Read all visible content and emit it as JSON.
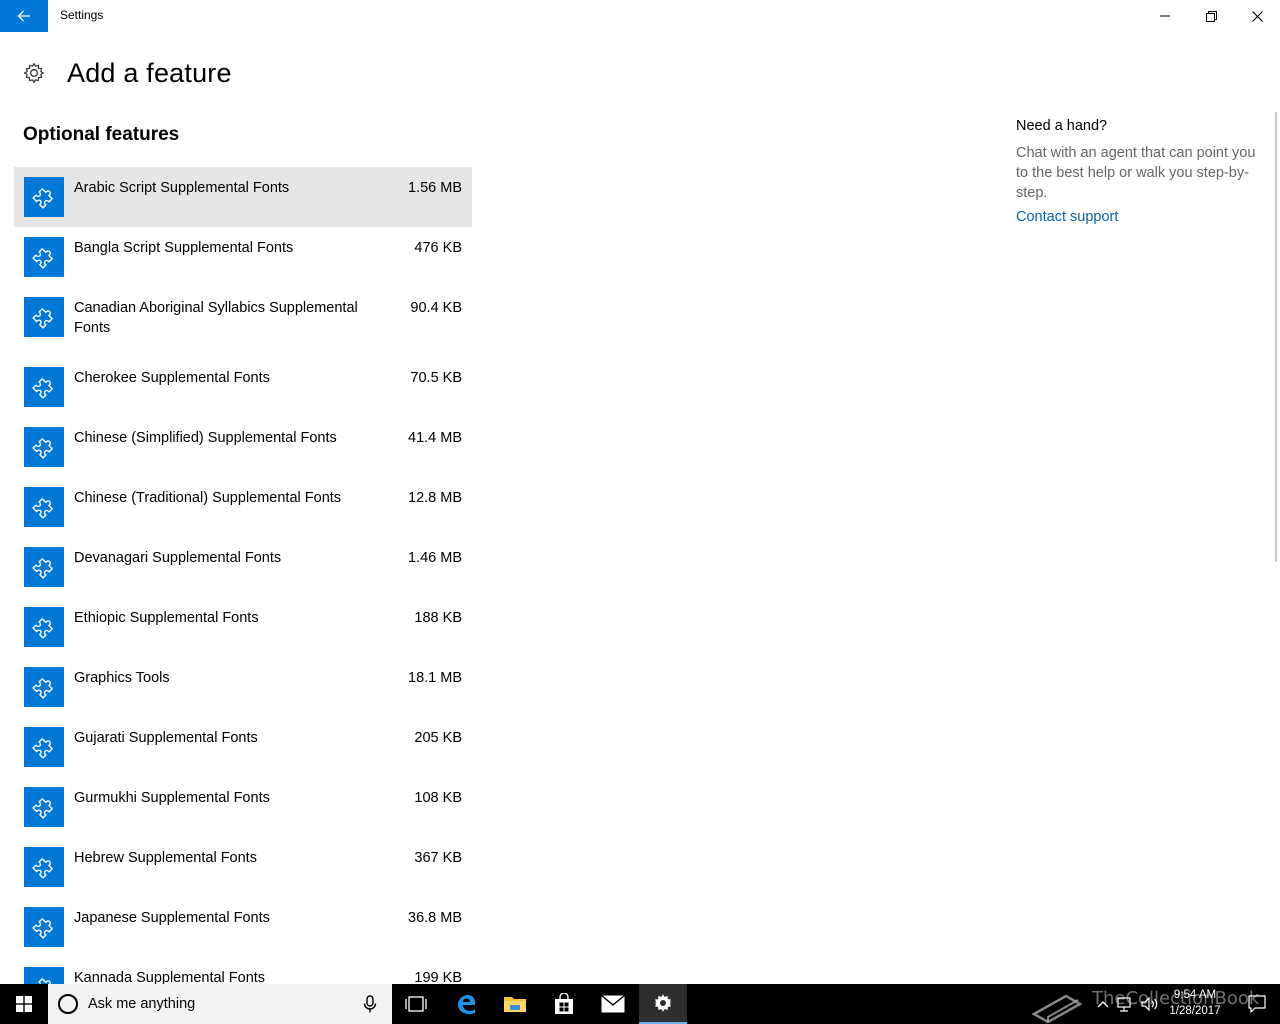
{
  "window": {
    "title": "Settings"
  },
  "page": {
    "title": "Add a feature",
    "section_title": "Optional features"
  },
  "features": [
    {
      "name": "Arabic Script Supplemental Fonts",
      "size": "1.56 MB"
    },
    {
      "name": "Bangla Script Supplemental Fonts",
      "size": "476 KB"
    },
    {
      "name": "Canadian Aboriginal Syllabics Supplemental Fonts",
      "size": "90.4 KB"
    },
    {
      "name": "Cherokee Supplemental Fonts",
      "size": "70.5 KB"
    },
    {
      "name": "Chinese (Simplified) Supplemental Fonts",
      "size": "41.4 MB"
    },
    {
      "name": "Chinese (Traditional) Supplemental Fonts",
      "size": "12.8 MB"
    },
    {
      "name": "Devanagari Supplemental Fonts",
      "size": "1.46 MB"
    },
    {
      "name": "Ethiopic Supplemental Fonts",
      "size": "188 KB"
    },
    {
      "name": "Graphics Tools",
      "size": "18.1 MB"
    },
    {
      "name": "Gujarati Supplemental Fonts",
      "size": "205 KB"
    },
    {
      "name": "Gurmukhi Supplemental Fonts",
      "size": "108 KB"
    },
    {
      "name": "Hebrew Supplemental Fonts",
      "size": "367 KB"
    },
    {
      "name": "Japanese Supplemental Fonts",
      "size": "36.8 MB"
    },
    {
      "name": "Kannada Supplemental Fonts",
      "size": "199 KB"
    }
  ],
  "help": {
    "title": "Need a hand?",
    "description": "Chat with an agent that can point you to the best help or walk you step-by-step.",
    "link": "Contact support"
  },
  "taskbar": {
    "search_placeholder": "Ask me anything",
    "time": "9:54 AM",
    "date": "1/28/2017",
    "watermark": "TheCollectionBook"
  },
  "colors": {
    "accent": "#0078d7",
    "link": "#0063b1",
    "selected_row": "#e6e6e6",
    "taskbar": "#000000"
  },
  "icons": {
    "back": "back-arrow-icon",
    "feature": "puzzle-piece-icon",
    "settings": "gear-icon"
  }
}
